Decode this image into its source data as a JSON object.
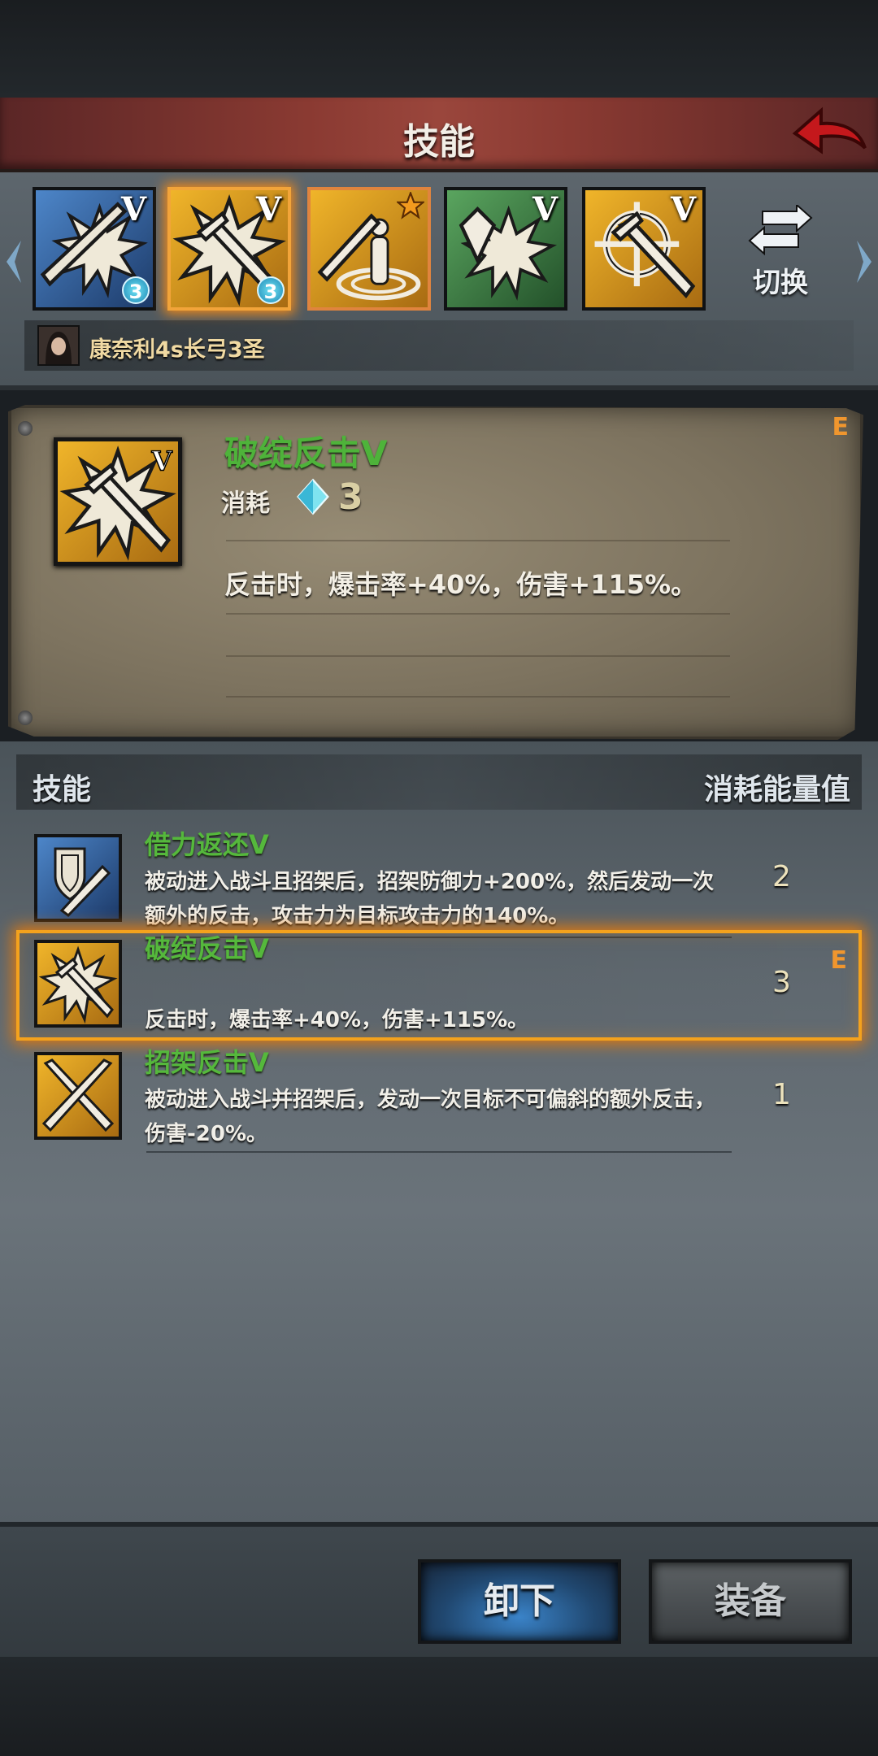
{
  "header": {
    "title": "技能",
    "back_icon": "back-arrow-icon"
  },
  "colors": {
    "accent_orange": "#f0962e",
    "skill_name_green": "#4eb33a",
    "banner_red": "#8a3a32",
    "unequip_blue": "#3a83c8"
  },
  "skill_bar": {
    "slots": [
      {
        "icon": "counter-slash-icon",
        "tier": "V",
        "badge": "3",
        "theme": "blue"
      },
      {
        "icon": "riposte-burst-icon",
        "tier": "V",
        "badge": "3",
        "theme": "gold",
        "selected": true
      },
      {
        "icon": "sword-stance-icon",
        "tier": "",
        "badge": "",
        "theme": "gold-star"
      },
      {
        "icon": "crystal-burst-icon",
        "tier": "V",
        "badge": "",
        "theme": "green"
      },
      {
        "icon": "target-strike-icon",
        "tier": "V",
        "badge": "",
        "theme": "gold"
      }
    ],
    "switch_label": "切换",
    "switch_icon": "swap-arrows-icon"
  },
  "character": {
    "name": "康奈利4s长弓3圣"
  },
  "detail": {
    "rank": "E",
    "name": "破绽反击V",
    "tier": "V",
    "cost_label": "消耗",
    "cost_icon": "energy-gem-icon",
    "cost_value": "3",
    "description": "反击时，爆击率+40%，伤害+115%。"
  },
  "list": {
    "header_left": "技能",
    "header_right": "消耗能量值",
    "items": [
      {
        "icon": "shield-sword-icon",
        "name": "借力返还V",
        "desc_line1": "被动进入战斗且招架后，招架防御力+200%，然后发动一次",
        "desc_line2": "额外的反击，攻击力为目标攻击力的140%。",
        "cost": "2",
        "rank": "",
        "selected": false
      },
      {
        "icon": "riposte-burst-icon",
        "name": "破绽反击V",
        "desc_line1": "",
        "desc_line2": "反击时，爆击率+40%，伤害+115%。",
        "cost": "3",
        "rank": "E",
        "selected": true
      },
      {
        "icon": "crossed-swords-icon",
        "name": "招架反击V",
        "desc_line1": "被动进入战斗并招架后，发动一次目标不可偏斜的额外反击，",
        "desc_line2": "伤害-20%。",
        "cost": "1",
        "rank": "",
        "selected": false
      }
    ]
  },
  "buttons": {
    "unequip_label": "卸下",
    "equip_label": "装备"
  }
}
